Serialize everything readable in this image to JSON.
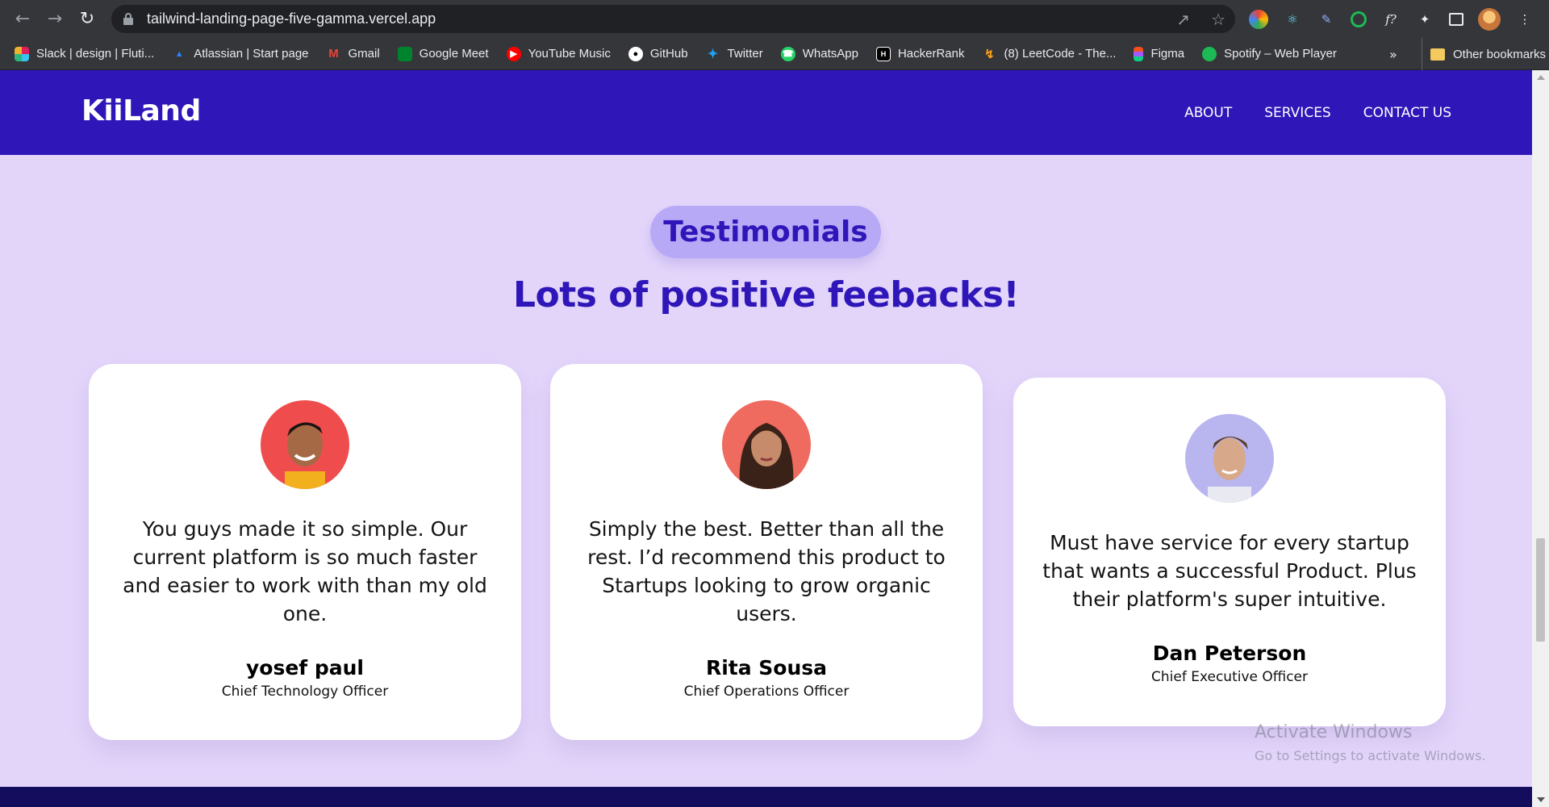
{
  "browser": {
    "url": "tailwind-landing-page-five-gamma.vercel.app",
    "bookmarks": [
      {
        "label": "Slack | design | Fluti...",
        "icon": "slack-icon",
        "color": "#e01e5a"
      },
      {
        "label": "Atlassian | Start page",
        "icon": "atlassian-icon",
        "color": "#2684ff"
      },
      {
        "label": "Gmail",
        "icon": "gmail-icon",
        "color": "#ea4335"
      },
      {
        "label": "Google Meet",
        "icon": "google-meet-icon",
        "color": "#00832d"
      },
      {
        "label": "YouTube Music",
        "icon": "youtube-music-icon",
        "color": "#ff0000"
      },
      {
        "label": "GitHub",
        "icon": "github-icon",
        "color": "#ffffff"
      },
      {
        "label": "Twitter",
        "icon": "twitter-icon",
        "color": "#1da1f2"
      },
      {
        "label": "WhatsApp",
        "icon": "whatsapp-icon",
        "color": "#25d366"
      },
      {
        "label": "HackerRank",
        "icon": "hackerrank-icon",
        "color": "#000000"
      },
      {
        "label": "(8) LeetCode - The...",
        "icon": "leetcode-icon",
        "color": "#ffa116"
      },
      {
        "label": "Figma",
        "icon": "figma-icon",
        "color": "#f24e1e"
      },
      {
        "label": "Spotify – Web Player",
        "icon": "spotify-icon",
        "color": "#1db954"
      }
    ],
    "more_bookmarks": "»",
    "other_bookmarks": "Other bookmarks"
  },
  "site": {
    "logo": "KiiLand",
    "nav": [
      "ABOUT",
      "SERVICES",
      "CONTACT US"
    ],
    "colors": {
      "primary": "#2e16b9",
      "background": "#e3d5fa",
      "pill": "#b8a9f7"
    }
  },
  "testimonials": {
    "badge": "Testimonials",
    "headline": "Lots of positive feebacks!",
    "cards": [
      {
        "quote": "You guys made it so simple. Our current platform is so much faster and easier to work with than my old one.",
        "name": "yosef paul",
        "role": "Chief Technology Officer",
        "avatar_bg": "#ef4d4d"
      },
      {
        "quote": "Simply the best. Better than all the rest. I’d recommend this product to Startups looking to grow organic users.",
        "name": "Rita Sousa",
        "role": "Chief Operations Officer",
        "avatar_bg": "#ef6b5f"
      },
      {
        "quote": "Must have service for every startup that wants a successful Product. Plus their platform's super intuitive.",
        "name": "Dan Peterson",
        "role": "Chief Executive Officer",
        "avatar_bg": "#b9b5ee"
      }
    ]
  },
  "os_watermark": {
    "title": "Activate Windows",
    "subtitle": "Go to Settings to activate Windows."
  }
}
